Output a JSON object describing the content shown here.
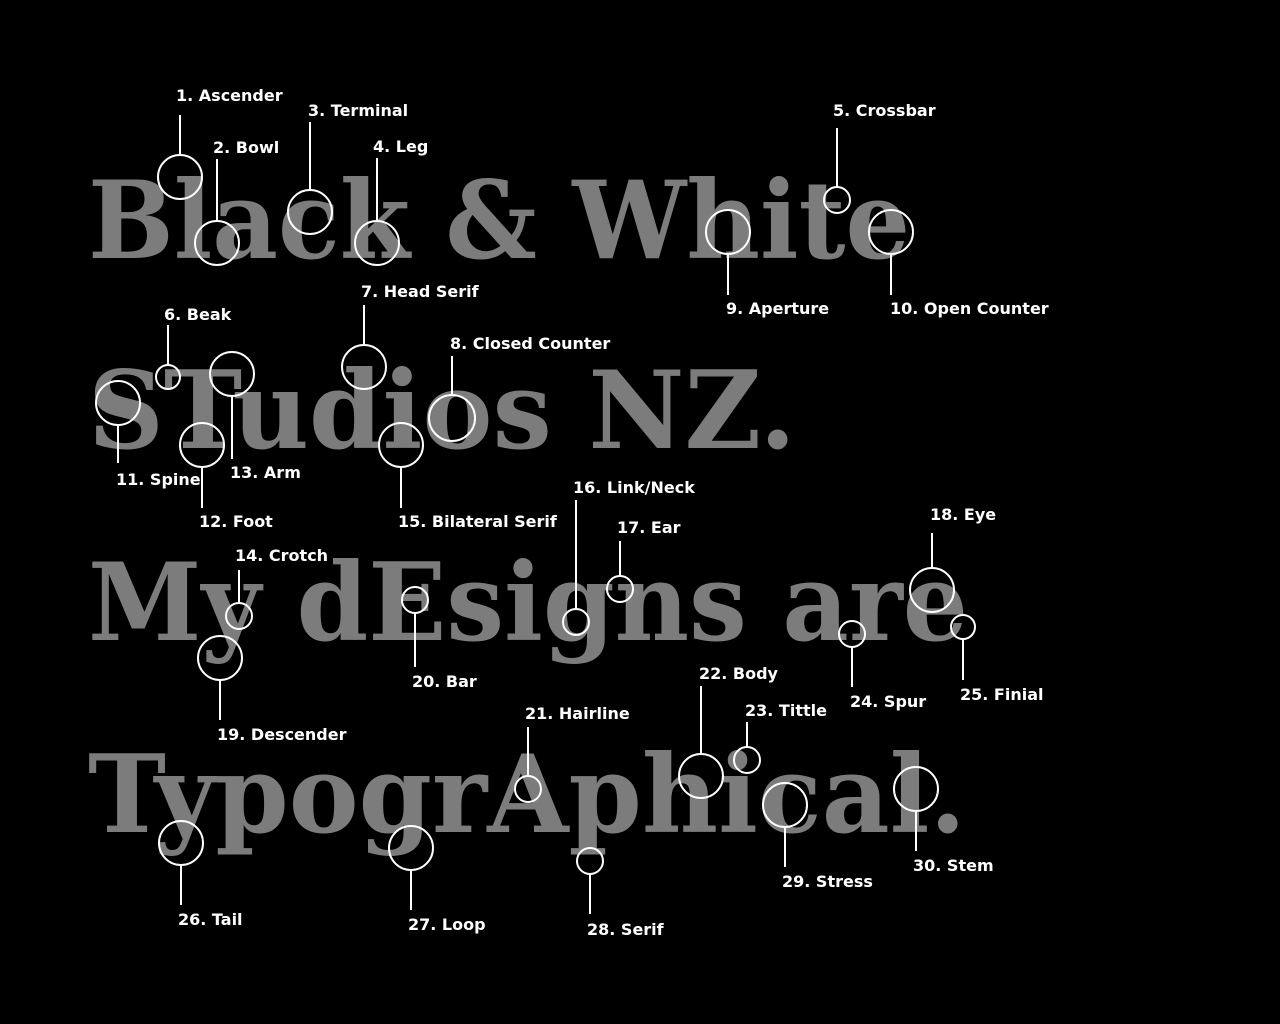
{
  "colors": {
    "background": "#000000",
    "specimen_text": "#7c7c7c",
    "annotation": "#ffffff"
  },
  "specimen_lines": [
    "Black & White",
    "STudios NZ.",
    "My dEsigns are",
    "TypogrAphical."
  ],
  "annotations": [
    "1. Ascender",
    "2. Bowl",
    "3. Terminal",
    "4. Leg",
    "5. Crossbar",
    "6. Beak",
    "7. Head Serif",
    "8. Closed Counter",
    "9. Aperture",
    "10. Open Counter",
    "11. Spine",
    "12. Foot",
    "13. Arm",
    "14. Crotch",
    "15. Bilateral Serif",
    "16. Link/Neck",
    "17. Ear",
    "18. Eye",
    "19. Descender",
    "20. Bar",
    "21. Hairline",
    "22. Body",
    "23. Tittle",
    "24. Spur",
    "25. Finial",
    "26. Tail",
    "27. Loop",
    "28. Serif",
    "29. Stress",
    "30. Stem"
  ]
}
